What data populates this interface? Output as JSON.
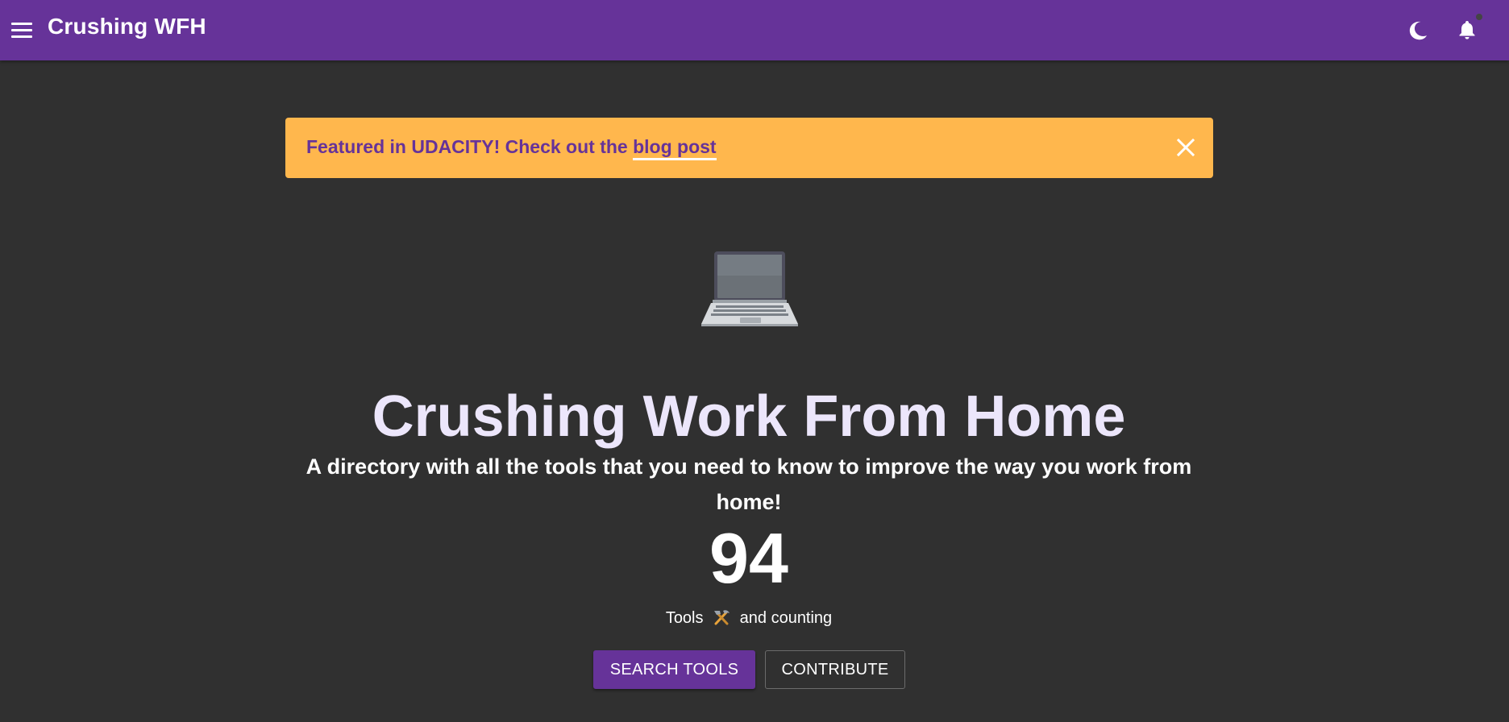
{
  "appbar": {
    "title": "Crushing WFH",
    "icons": [
      "menu-icon",
      "moon-icon",
      "bell-icon"
    ],
    "color": "#663399"
  },
  "banner": {
    "text": "Featured in UDACITY! Check out the ",
    "link_text": "blog post",
    "close_icon": "close-icon",
    "background": "#ffb74d"
  },
  "hero": {
    "emoji": "laptop-icon",
    "title": "Crushing Work From Home",
    "subtitle": "A directory with all the tools that you need to know to improve the way you work from home!",
    "count": "94",
    "count_prefix": "Tools",
    "count_suffix": "and counting",
    "count_icon": "hammer-and-pick-icon"
  },
  "actions": {
    "search_label": "SEARCH TOOLS",
    "contribute_label": "CONTRIBUTE"
  },
  "theme": {
    "background": "#303030",
    "title_color": "#ece6fb"
  }
}
